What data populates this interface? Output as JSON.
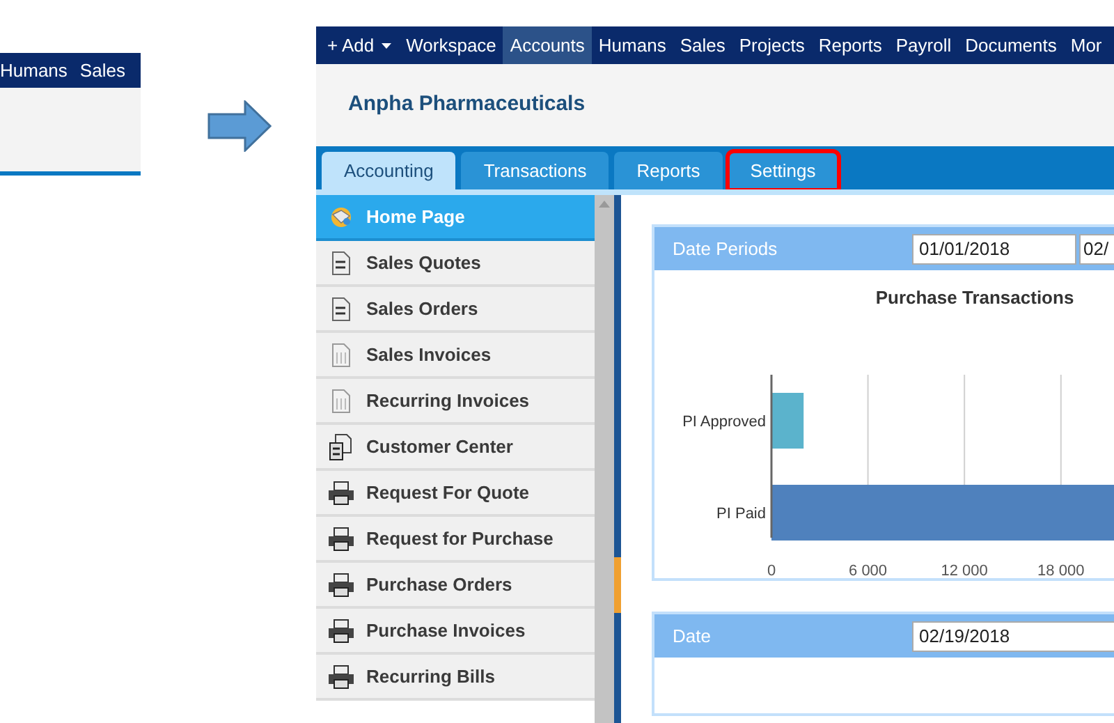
{
  "snippet": {
    "nav_items": [
      "Humans",
      "Sales"
    ]
  },
  "app": {
    "nav": {
      "add_label": "+ Add",
      "items": [
        {
          "label": "Workspace",
          "selected": false
        },
        {
          "label": "Accounts",
          "selected": true
        },
        {
          "label": "Humans",
          "selected": false
        },
        {
          "label": "Sales",
          "selected": false
        },
        {
          "label": "Projects",
          "selected": false
        },
        {
          "label": "Reports",
          "selected": false
        },
        {
          "label": "Payroll",
          "selected": false
        },
        {
          "label": "Documents",
          "selected": false
        },
        {
          "label": "Mor",
          "selected": false
        }
      ]
    },
    "company": "Anpha Pharmaceuticals",
    "tabs": [
      {
        "label": "Accounting",
        "selected": true,
        "highlighted": false
      },
      {
        "label": "Transactions",
        "selected": false,
        "highlighted": false
      },
      {
        "label": "Reports",
        "selected": false,
        "highlighted": false
      },
      {
        "label": "Settings",
        "selected": false,
        "highlighted": true
      }
    ],
    "sidebar": {
      "items": [
        {
          "label": "Home Page",
          "kind": "home",
          "selected": true
        },
        {
          "label": "Sales Quotes",
          "kind": "doc-arrows",
          "selected": false
        },
        {
          "label": "Sales Orders",
          "kind": "doc-arrows",
          "selected": false
        },
        {
          "label": "Sales Invoices",
          "kind": "doc-lines",
          "selected": false
        },
        {
          "label": "Recurring Invoices",
          "kind": "doc-lines",
          "selected": false
        },
        {
          "label": "Customer Center",
          "kind": "doc-stack",
          "selected": false
        },
        {
          "label": "Request For Quote",
          "kind": "printer",
          "selected": false
        },
        {
          "label": "Request for Purchase",
          "kind": "printer",
          "selected": false
        },
        {
          "label": "Purchase Orders",
          "kind": "printer",
          "selected": false
        },
        {
          "label": "Purchase Invoices",
          "kind": "printer",
          "selected": false
        },
        {
          "label": "Recurring Bills",
          "kind": "printer",
          "selected": false
        }
      ]
    },
    "date_periods_panel": {
      "title": "Date Periods",
      "from": "01/01/2018",
      "to": "02/",
      "chart_data": {
        "type": "bar",
        "orientation": "horizontal",
        "title": "Purchase Transactions",
        "categories": [
          "PI Approved",
          "PI Paid"
        ],
        "series": [
          {
            "colors": [
              "#5bb3cc",
              "#4f81bd"
            ],
            "values": [
              2000,
              21300
            ]
          }
        ],
        "grid": true,
        "xlim": [
          0,
          21300
        ],
        "xticks": [
          {
            "value": 0,
            "label": "0"
          },
          {
            "value": 6000,
            "label": "6 000"
          },
          {
            "value": 12000,
            "label": "12 000"
          },
          {
            "value": 18000,
            "label": "18 000"
          }
        ]
      }
    },
    "date_panel": {
      "title": "Date",
      "value": "02/19/2018"
    }
  }
}
